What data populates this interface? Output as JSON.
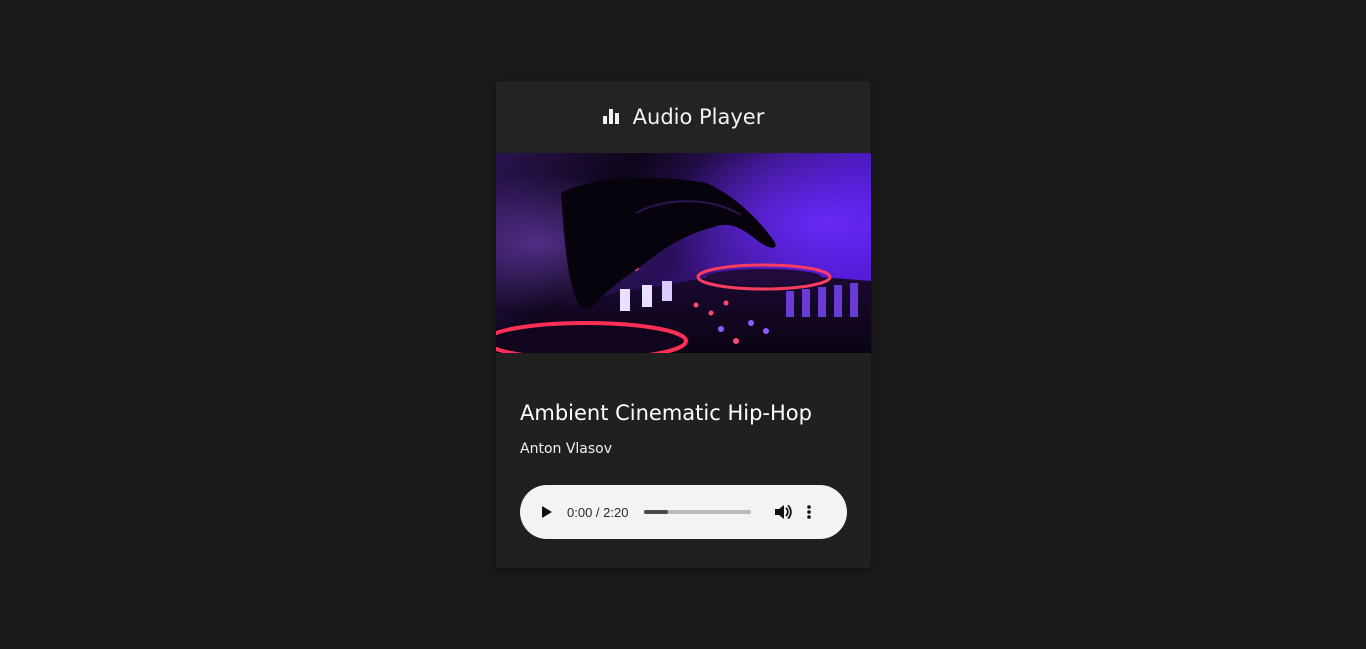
{
  "header": {
    "icon": "equalizer-icon",
    "title": "Audio Player"
  },
  "cover": {
    "alt_icon": "dj-mixer-image"
  },
  "track": {
    "title": "Ambient Cinematic Hip-Hop",
    "artist": "Anton Vlasov"
  },
  "player": {
    "time": "0:00 / 2:20",
    "progress_fraction": 0.22,
    "play_icon": "play-icon",
    "volume_icon": "volume-icon",
    "more_icon": "more-vertical-icon"
  },
  "colors": {
    "page_background": "#191919",
    "card_background": "#202020",
    "player_background": "#f1f3f4"
  }
}
